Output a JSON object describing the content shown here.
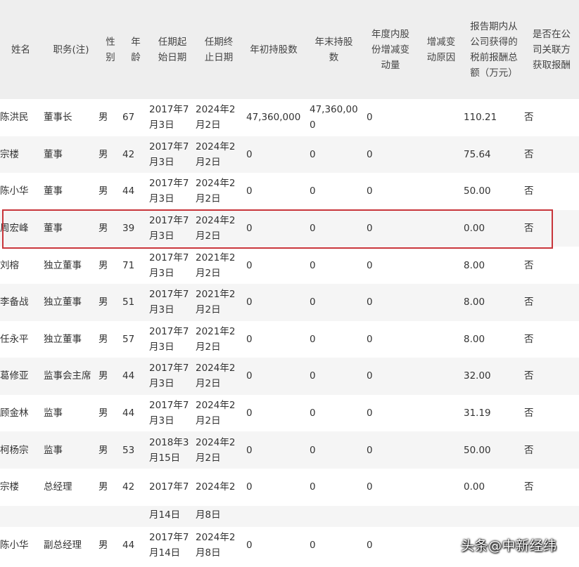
{
  "headers": [
    "姓名",
    "职务(注)",
    "性别",
    "年龄",
    "任期起始日期",
    "任期终止日期",
    "年初持股数",
    "年末持股数",
    "年度内股份增减变动量",
    "增减变动原因",
    "报告期内从公司获得的税前报酬总额（万元）",
    "是否在公司关联方获取报酬"
  ],
  "rows": [
    [
      "陈洪民",
      "董事长",
      "男",
      "67",
      "2017年7月3日",
      "2024年2月2日",
      "47,360,000",
      "47,360,000",
      "0",
      "",
      "110.21",
      "否"
    ],
    [
      "宗楼",
      "董事",
      "男",
      "42",
      "2017年7月3日",
      "2024年2月2日",
      "0",
      "0",
      "0",
      "",
      "75.64",
      "否"
    ],
    [
      "陈小华",
      "董事",
      "男",
      "44",
      "2017年7月3日",
      "2024年2月2日",
      "0",
      "0",
      "0",
      "",
      "50.00",
      "否"
    ],
    [
      "周宏峰",
      "董事",
      "男",
      "39",
      "2017年7月3日",
      "2024年2月2日",
      "0",
      "0",
      "0",
      "",
      "0.00",
      "否"
    ],
    [
      "刘榕",
      "独立董事",
      "男",
      "71",
      "2017年7月3日",
      "2021年2月2日",
      "0",
      "0",
      "0",
      "",
      "8.00",
      "否"
    ],
    [
      "李备战",
      "独立董事",
      "男",
      "51",
      "2017年7月3日",
      "2021年2月2日",
      "0",
      "0",
      "0",
      "",
      "8.00",
      "否"
    ],
    [
      "任永平",
      "独立董事",
      "男",
      "57",
      "2017年7月3日",
      "2021年2月2日",
      "0",
      "0",
      "0",
      "",
      "8.00",
      "否"
    ],
    [
      "葛修亚",
      "监事会主席",
      "男",
      "44",
      "2017年7月3日",
      "2024年2月2日",
      "0",
      "0",
      "0",
      "",
      "32.00",
      "否"
    ],
    [
      "顾金林",
      "监事",
      "男",
      "44",
      "2017年7月3日",
      "2024年2月2日",
      "0",
      "0",
      "0",
      "",
      "31.19",
      "否"
    ],
    [
      "柯杨宗",
      "监事",
      "男",
      "53",
      "2018年3月15日",
      "2024年2月2日",
      "0",
      "0",
      "0",
      "",
      "50.00",
      "否"
    ],
    [
      "宗楼",
      "总经理",
      "男",
      "42",
      "2017年7",
      "2024年2",
      "0",
      "0",
      "0",
      "",
      "0.00",
      "否"
    ],
    [
      "",
      "",
      "",
      "",
      "月14日",
      "月8日",
      "",
      "",
      "",
      "",
      "",
      ""
    ],
    [
      "陈小华",
      "副总经理",
      "男",
      "44",
      "2017年7月14日",
      "2024年2月8日",
      "0",
      "0",
      "0",
      "",
      "",
      ""
    ]
  ],
  "watermark": "头条@中新经纬",
  "colors": {
    "header_bg": "#eeeeee",
    "row_alt_bg": "#f5f5f5",
    "highlight_border": "#c8353a",
    "text": "#333333"
  }
}
